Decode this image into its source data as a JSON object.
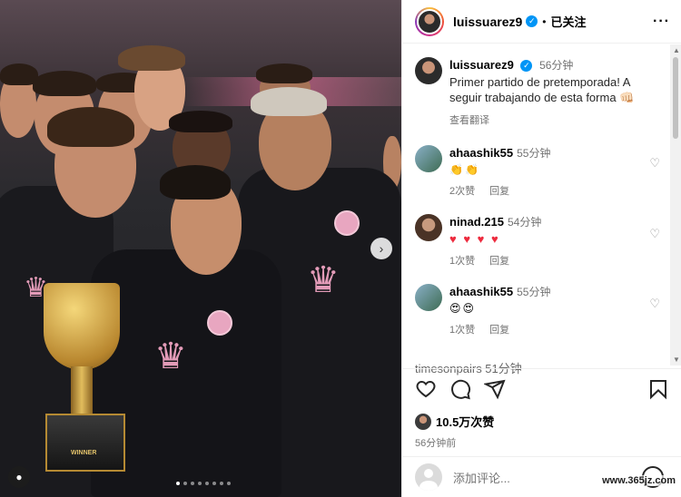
{
  "header": {
    "username": "luissuarez9",
    "separator": "•",
    "follow_status": "已关注",
    "more": "···"
  },
  "caption": {
    "username": "luissuarez9",
    "time": "56分钟",
    "text": "Primer partido de pretemporada! A seguir trabajando de esta forma 👊🏻",
    "translate": "查看翻译"
  },
  "comments": [
    {
      "username": "ahaashik55",
      "time": "55分钟",
      "emoji": "👏👏",
      "likes": "2次赞",
      "reply": "回复"
    },
    {
      "username": "ninad.215",
      "time": "54分钟",
      "emoji": "♥ ♥ ♥ ♥",
      "likes": "1次赞",
      "reply": "回复"
    },
    {
      "username": "ahaashik55",
      "time": "55分钟",
      "emoji": "😍😍",
      "likes": "1次赞",
      "reply": "回复"
    }
  ],
  "partial_comment": "timesonpairs  51分钟",
  "post": {
    "likes": "10.5万次赞",
    "time_ago": "56分钟前"
  },
  "add_comment": {
    "placeholder": "添加评论..."
  },
  "photo": {
    "trophy_text": "WINNER"
  },
  "watermark": "www.365jz.com",
  "icons": [
    "like-heart-icon",
    "comment-icon",
    "share-icon",
    "save-icon"
  ],
  "colors": {
    "verified": "#0095f6",
    "crown": "#e39bb8",
    "heart": "#ed2b3e"
  }
}
